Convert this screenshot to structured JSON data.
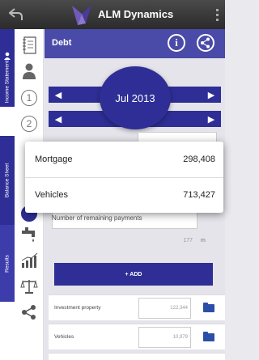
{
  "app": {
    "title": "ALM Dynamics"
  },
  "sections": [
    {
      "label": "Income Statement"
    },
    {
      "label": "Balance Sheet"
    },
    {
      "label": "Results"
    }
  ],
  "sidebar": {
    "steps": [
      "1",
      "2"
    ]
  },
  "header": {
    "title": "Debt"
  },
  "period": {
    "month": "Jul 2013"
  },
  "popup": {
    "items": [
      {
        "label": "Mortgage",
        "value": "298,408"
      },
      {
        "label": "Vehicles",
        "value": "713,427"
      }
    ]
  },
  "remaining_payments": {
    "label": "Number of remaining payments",
    "value": "177",
    "unit": "m"
  },
  "add_button": {
    "label": "+ ADD"
  },
  "list": [
    {
      "label": "Investment property",
      "value": "122,344"
    },
    {
      "label": "Vehicles",
      "value": "10,979"
    }
  ],
  "colors": {
    "accent": "#2e2e96",
    "header": "#4a4aa8",
    "topbar": "#333333"
  }
}
